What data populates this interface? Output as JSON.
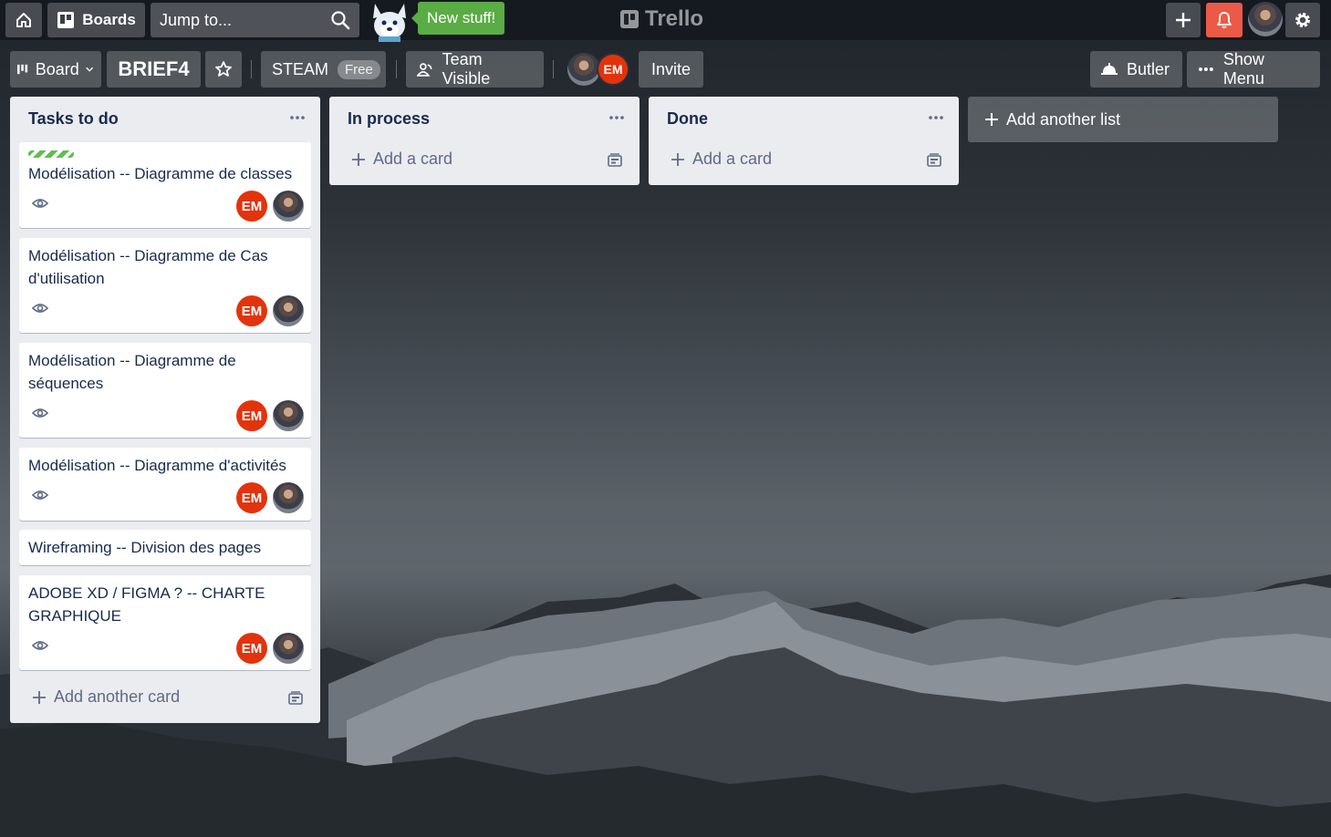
{
  "topnav": {
    "boards_label": "Boards",
    "search_placeholder": "Jump to...",
    "new_stuff": "New stuff!",
    "logo": "Trello"
  },
  "board_header": {
    "view_label": "Board",
    "board_title": "BRIEF4",
    "team_name": "STEAM",
    "team_plan": "Free",
    "visibility": "Team Visible",
    "member_initials": "EM",
    "invite_label": "Invite",
    "butler_label": "Butler",
    "menu_label": "Show Menu"
  },
  "lists": [
    {
      "title": "Tasks to do",
      "cards": [
        {
          "text": "Modélisation -- Diagramme de classes",
          "members": [
            "EM"
          ]
        },
        {
          "text": "Modélisation -- Diagramme de Cas d'utilisation",
          "members": [
            "EM"
          ]
        },
        {
          "text": "Modélisation -- Diagramme de séquences",
          "members": [
            "EM"
          ]
        },
        {
          "text": "Modélisation -- Diagramme d'activités",
          "members": [
            "EM"
          ]
        },
        {
          "text": "Wireframing -- Division des pages",
          "members": []
        },
        {
          "text": "ADOBE XD / FIGMA ? -- CHARTE GRAPHIQUE",
          "members": [
            "EM"
          ]
        }
      ],
      "add_label": "Add another card"
    },
    {
      "title": "In process",
      "cards": [],
      "add_label": "Add a card"
    },
    {
      "title": "Done",
      "cards": [],
      "add_label": "Add a card"
    }
  ],
  "add_list_label": "Add another list",
  "colors": {
    "new_stuff_green": "#5aac44",
    "notification_red": "#eb5a46",
    "member_badge_red": "#e3330c",
    "label_green": "#61bd4f",
    "list_bg": "#ebecf0"
  }
}
